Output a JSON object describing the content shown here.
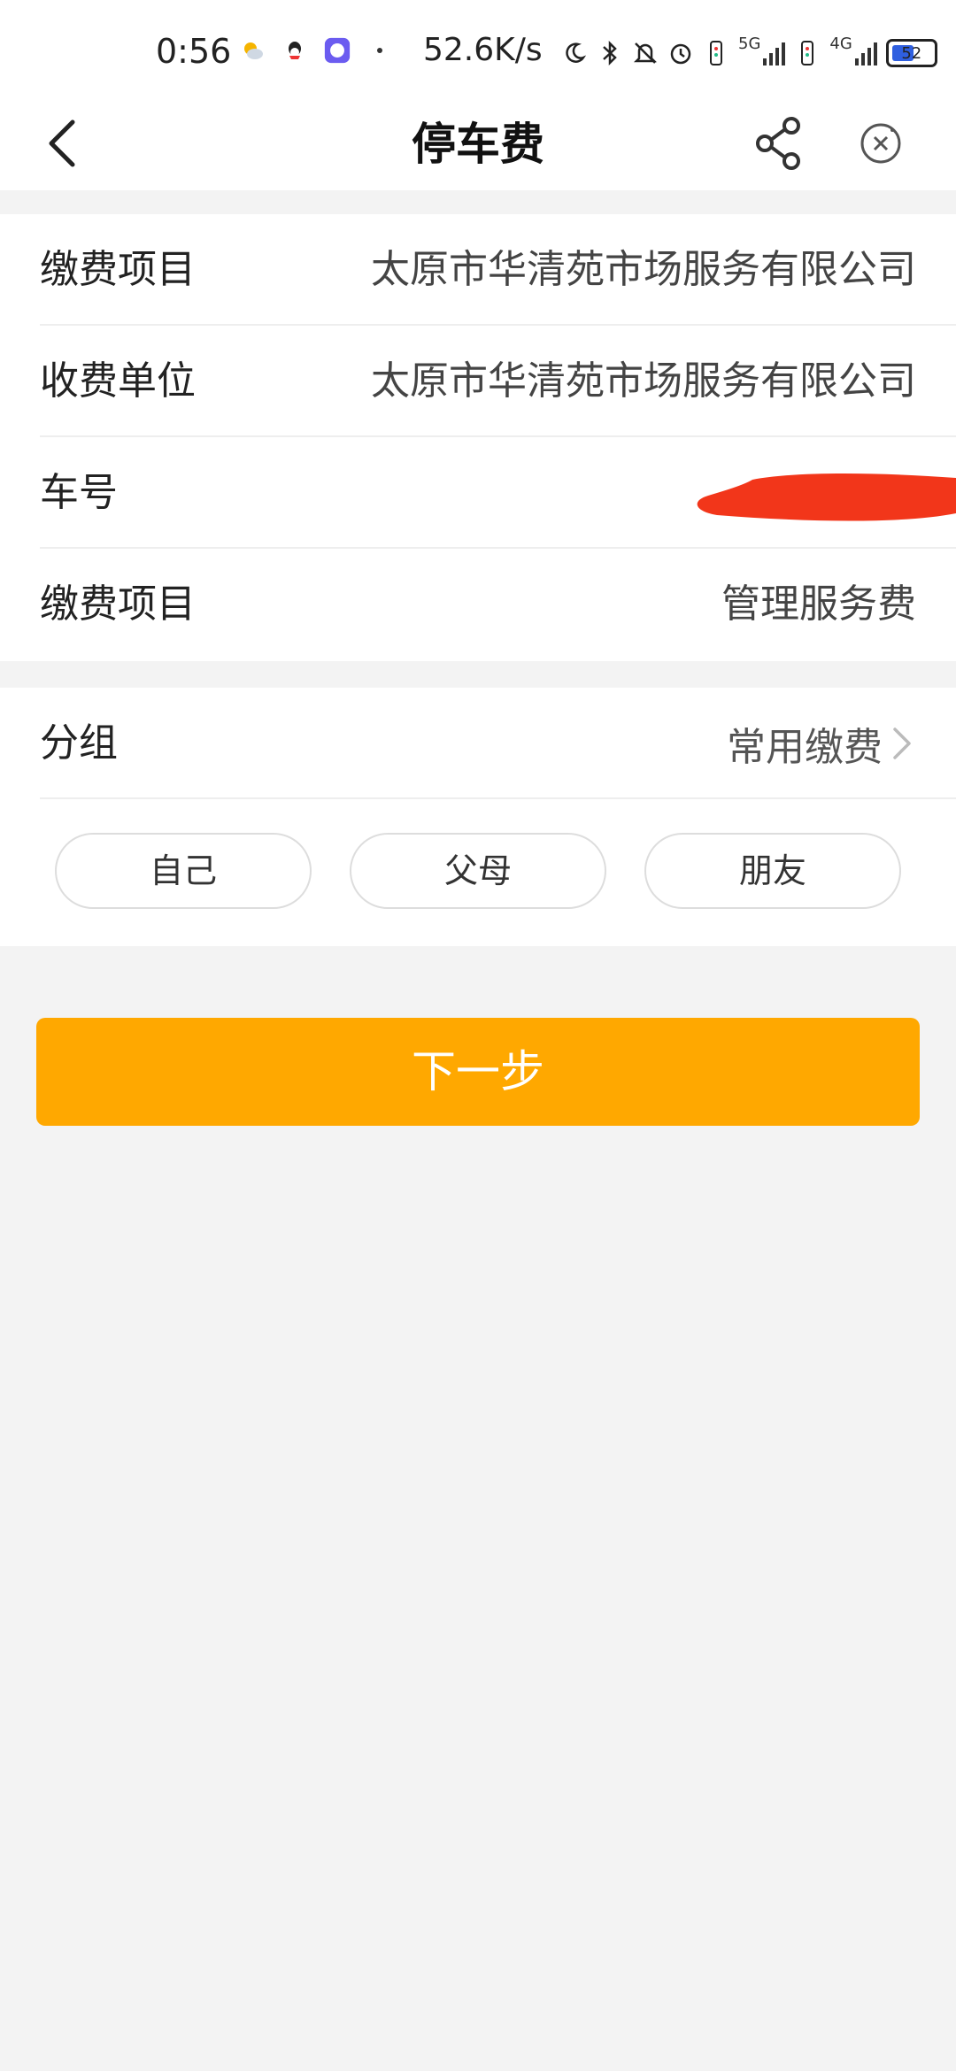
{
  "status_bar": {
    "time": "0:56",
    "network_speed": "52.6K/s",
    "net1": "5G",
    "net2": "4G",
    "battery": "52",
    "icons": [
      "weather-icon",
      "qq-icon",
      "chat-app-icon",
      "dot-icon",
      "moon-icon",
      "bluetooth-icon",
      "mute-icon",
      "alarm-icon",
      "sim-icon",
      "signal-icon",
      "battery-icon"
    ]
  },
  "header": {
    "title": "停车费",
    "icons": [
      "back-icon",
      "share-icon",
      "close-icon"
    ]
  },
  "info": {
    "rows": [
      {
        "label": "缴费项目",
        "value": "太原市华清苑市场服务有限公司"
      },
      {
        "label": "收费单位",
        "value": "太原市华清苑市场服务有限公司"
      },
      {
        "label": "车号",
        "value": ""
      },
      {
        "label": "缴费项目",
        "value": "管理服务费"
      }
    ]
  },
  "group": {
    "label": "分组",
    "value": "常用缴费",
    "chips": [
      "自己",
      "父母",
      "朋友"
    ]
  },
  "actions": {
    "next_label": "下一步"
  },
  "colors": {
    "accent": "#ffa800",
    "background": "#f3f3f3",
    "redaction": "#f2361a"
  }
}
